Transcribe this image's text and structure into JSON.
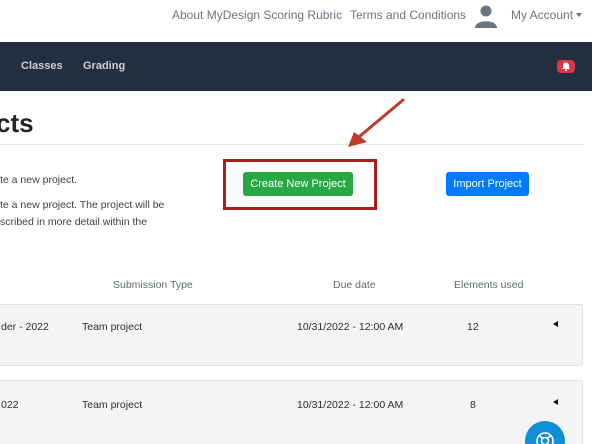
{
  "topbar": {
    "about_link": "About MyDesign Scoring Rubric",
    "terms_link": "Terms and Conditions",
    "account_label": "My Account",
    "avatar_icon": "user-silhouette-icon"
  },
  "navbar": {
    "items": [
      {
        "label": "Classes"
      },
      {
        "label": "Grading"
      }
    ],
    "notification_icon": "bell-icon",
    "background": "#232f3e"
  },
  "page": {
    "title": "cts",
    "create_desc": "te a new project.",
    "import_desc_line1": "te a new project. The project will be",
    "import_desc_line2": "scribed in more detail within the",
    "create_button": "Create New Project",
    "import_button": "Import Project"
  },
  "annotation": {
    "box_color": "#a5201b",
    "arrow_icon": "arrow-down-left-icon"
  },
  "table": {
    "headers": {
      "submission_type": "Submission Type",
      "due_date": "Due date",
      "elements_used": "Elements used"
    },
    "rows": [
      {
        "name": "der - 2022",
        "submission_type": "Team project",
        "due_date": "10/31/2022 - 12:00 AM",
        "elements_used": "12"
      },
      {
        "name": "022",
        "submission_type": "Team project",
        "due_date": "10/31/2022 - 12:00 AM",
        "elements_used": "8"
      }
    ]
  },
  "colors": {
    "create_button": "#28a745",
    "import_button": "#007bff",
    "help_button": "#0e8fd6"
  },
  "help_button_icon": "lifebuoy-icon"
}
